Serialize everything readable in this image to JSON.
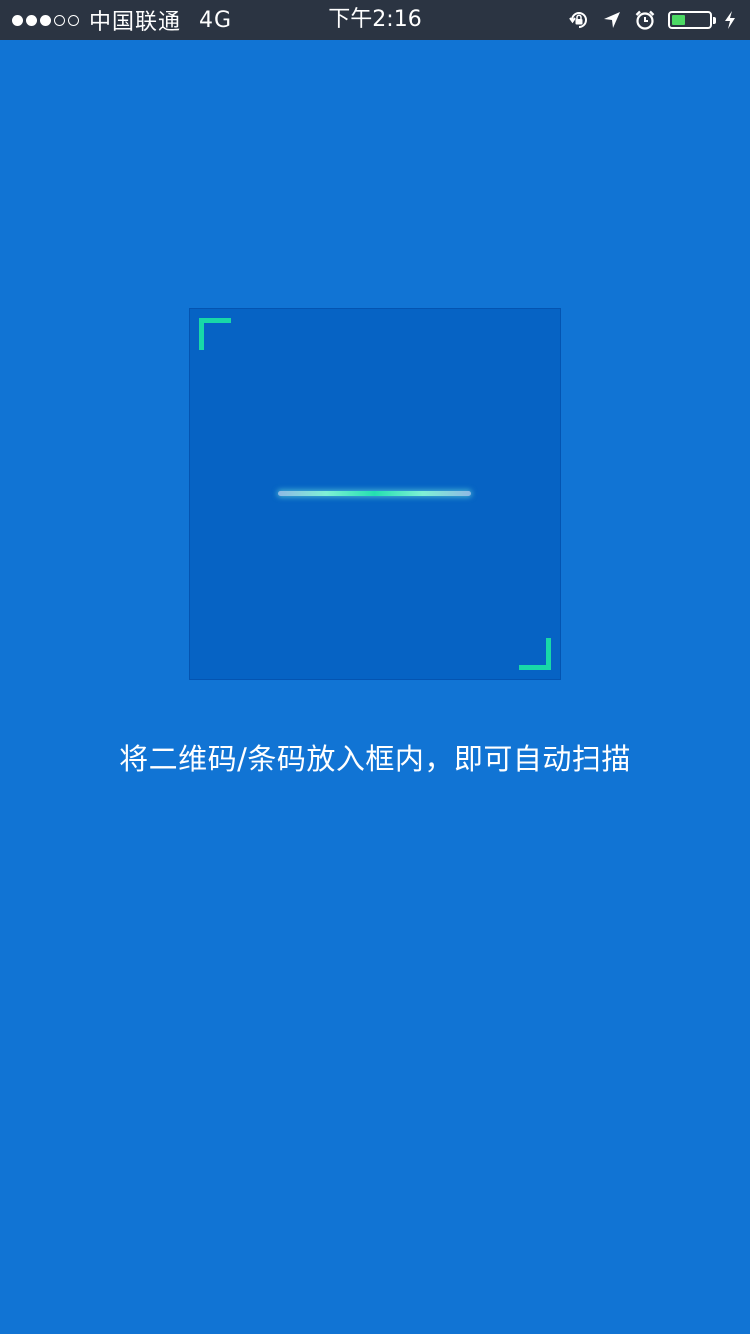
{
  "status_bar": {
    "signal_dots_filled": 3,
    "signal_dots_total": 5,
    "carrier": "中国联通",
    "network": "4G",
    "time": "下午2:16",
    "icons": [
      "rotation-lock-icon",
      "location-arrow-icon",
      "alarm-icon",
      "battery-icon",
      "charging-bolt-icon"
    ],
    "battery_level": 0.35,
    "battery_fill_color": "#4cd964"
  },
  "scanner": {
    "frame_color": "#0663c4",
    "corner_color": "#18d8a8",
    "hint": "将二维码/条码放入框内，即可自动扫描"
  },
  "colors": {
    "background": "#1174d4",
    "status_bar_bg": "#2b3442"
  }
}
